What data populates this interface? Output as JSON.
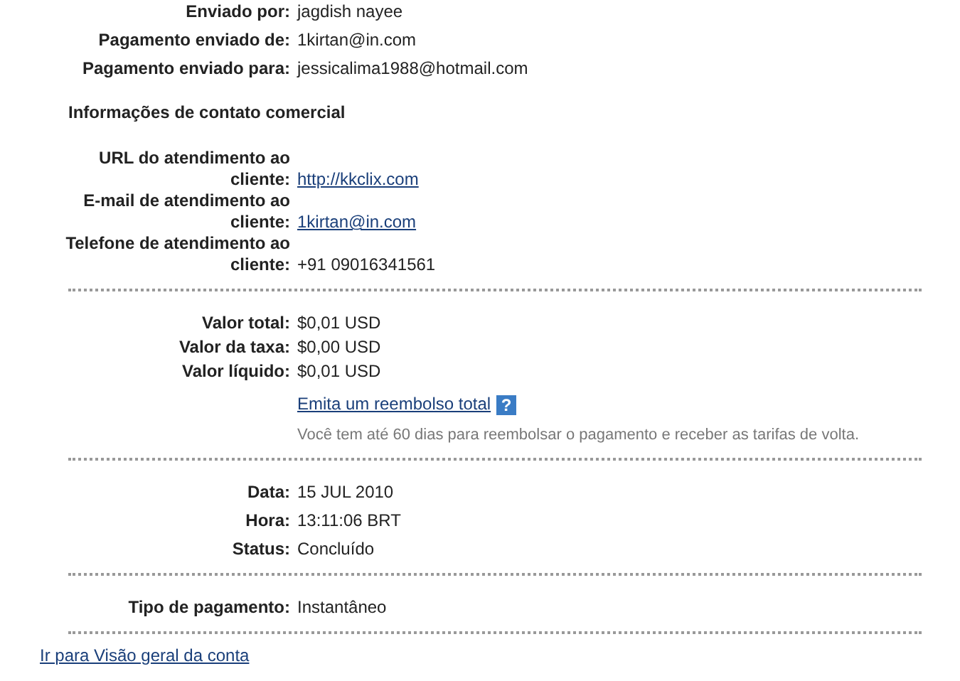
{
  "sections": [
    {
      "rows": [
        {
          "label": "Enviado por:",
          "value": "jagdish nayee",
          "kind": "text"
        },
        {
          "label": "Pagamento enviado de:",
          "value": "1kirtan@in.com",
          "kind": "text"
        },
        {
          "label": "Pagamento enviado para:",
          "value": "jessicalima1988@hotmail.com",
          "kind": "text"
        }
      ]
    },
    {
      "heading": "Informações de contato comercial",
      "rows": [
        {
          "label": "URL do atendimento ao cliente:",
          "value": "http://kkclix.com",
          "kind": "link"
        },
        {
          "label": "E-mail de atendimento ao cliente:",
          "value": "1kirtan@in.com",
          "kind": "link"
        },
        {
          "label": "Telefone de atendimento ao cliente:",
          "value": "+91 09016341561",
          "kind": "text"
        }
      ]
    },
    {
      "rows": [
        {
          "label": "Valor total:",
          "value": "$0,01 USD",
          "kind": "text"
        },
        {
          "label": "Valor da taxa:",
          "value": "$0,00 USD",
          "kind": "text"
        },
        {
          "label": "Valor líquido:",
          "value": "$0,01 USD",
          "kind": "text"
        }
      ],
      "refund": {
        "link": "Emita um reembolso total",
        "help": "?",
        "note": "Você tem até 60 dias para reembolsar o pagamento e receber as tarifas de volta."
      }
    },
    {
      "rows": [
        {
          "label": "Data:",
          "value": "15 JUL 2010",
          "kind": "text"
        },
        {
          "label": "Hora:",
          "value": "13:11:06 BRT",
          "kind": "text"
        },
        {
          "label": "Status:",
          "value": "Concluído",
          "kind": "text"
        }
      ]
    },
    {
      "rows": [
        {
          "label": "Tipo de pagamento:",
          "value": "Instantâneo",
          "kind": "text"
        }
      ]
    }
  ],
  "footer_link": "Ir para Visão geral da conta"
}
